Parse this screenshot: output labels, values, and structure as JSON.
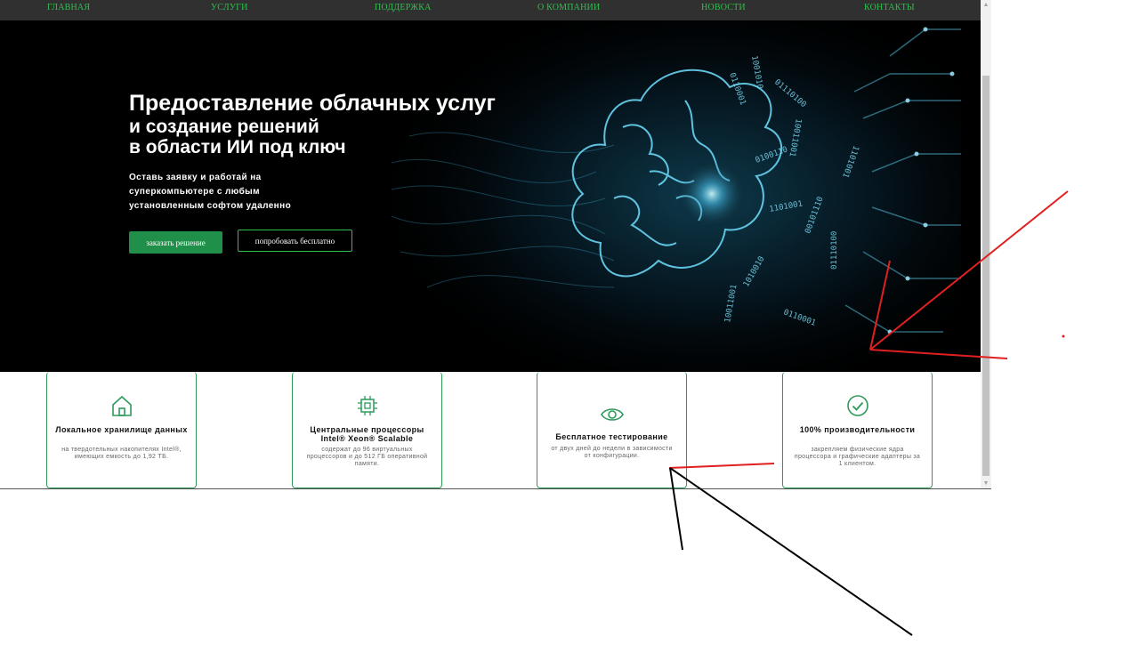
{
  "nav": {
    "items": [
      "ГЛАВНАЯ",
      "УСЛУГИ",
      "ПОДДЕРЖКА",
      "О КОМПАНИИ",
      "НОВОСТИ",
      "КОНТАКТЫ"
    ]
  },
  "hero": {
    "title_line1": "Предоставление облачных услуг",
    "title_line2": "и создание решений",
    "title_line3": "в области ИИ под ключ",
    "subtitle": "Оставь заявку и работай на суперкомпьютере с любым установленным софтом удаленно",
    "primary_button": "заказать решение",
    "secondary_button": "попробовать бесплатно",
    "binary_strings": [
      "0110001",
      "1001010",
      "01110100",
      "10011001",
      "0100110",
      "1101001",
      "00101110",
      "1010010"
    ]
  },
  "features": [
    {
      "icon": "home-icon",
      "title": "Локальное хранилище данных",
      "desc": "на твердотельных накопителях Intel®, имеющих емкость до 1,92 ТБ."
    },
    {
      "icon": "cpu-chip-icon",
      "title": "Центральные процессоры Intel® Xeon® Scalable",
      "desc": "содержат до 96 виртуальных процессоров и до 512 ГБ оперативной памяти."
    },
    {
      "icon": "eye-icon",
      "title": "Бесплатное тестирование",
      "desc": "от двух дней до недели в зависимости от конфигурации."
    },
    {
      "icon": "check-circle-icon",
      "title": "100% производительности",
      "desc": "закрепляем физические ядра процессора и графические адаптеры за 1 клиентом."
    }
  ],
  "colors": {
    "accent_green": "#2fbf4e",
    "button_green": "#1f8f49",
    "card_border": "#2e9a5a",
    "nav_bg": "#303030",
    "hero_bg": "#000000",
    "annotation_red": "#e02020",
    "annotation_black": "#000000"
  }
}
